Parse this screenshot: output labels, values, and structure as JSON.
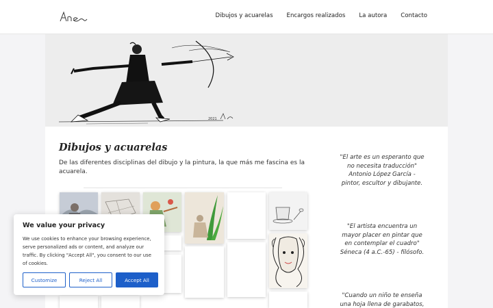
{
  "header": {
    "logo_text": "Ane",
    "nav": [
      {
        "label": "Dibujos y acuarelas"
      },
      {
        "label": "Encargos realizados"
      },
      {
        "label": "La autora"
      },
      {
        "label": "Contacto"
      }
    ]
  },
  "main": {
    "title": "Dibujos y acuarelas",
    "intro": "De las diferentes disciplinas del dibujo y la pintura, la que más me fascina es la acuarela."
  },
  "quotes": [
    {
      "lines": [
        "\"El arte es un esperanto que",
        "no necesita traducción\"",
        "Antonio López García -",
        "pintor, escultor y dibujante."
      ]
    },
    {
      "lines": [
        "\"El artista encuentra un",
        "mayor placer en pintar que",
        "en contemplar el cuadro\"",
        "Séneca (4 a.C.-65) - filósofo."
      ]
    },
    {
      "lines": [
        "\"Cuando un niño te enseña",
        "una hoja llena de garabatos,"
      ]
    }
  ],
  "cookie_banner": {
    "title": "We value your privacy",
    "text": "We use cookies to enhance your browsing experience, serve personalized ads or content, and analyze our traffic. By clicking \"Accept All\", you consent to our use of cookies.",
    "customize_label": "Customize",
    "reject_label": "Reject All",
    "accept_label": "Accept All",
    "accent_color": "#1d5fc9"
  }
}
